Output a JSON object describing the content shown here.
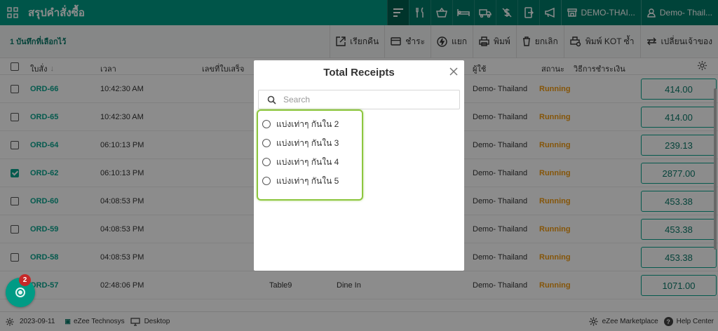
{
  "topbar": {
    "title": "สรุปคำสั่งซื้อ",
    "location_label": "DEMO-THAI...",
    "user_label": "Demo- Thail..."
  },
  "toolbar": {
    "selected_count": "1 บันทึกที่เลือกไว้",
    "recall_label": "เรียกคืน",
    "pay_label": "ชำระ",
    "split_label": "แยก",
    "print_label": "พิมพ์",
    "cancel_label": "ยกเลิก",
    "print_kot_label": "พิมพ์ KOT ซ้ำ",
    "change_owner_label": "เปลี่ยนเจ้าของ"
  },
  "table": {
    "headers": {
      "order": "ใบสั่ง",
      "time": "เวลา",
      "receipt_no": "เลขที่ใบเสร็จ",
      "user": "ผู้ใช้",
      "status": "สถานะ",
      "payment_method": "วิธีการชำระเงิน"
    },
    "rows": [
      {
        "order": "ORD-66",
        "time": "10:42:30 AM",
        "table": "",
        "type": "",
        "user": "Demo- Thailand",
        "status": "Running",
        "amount": "414.00",
        "checked": false
      },
      {
        "order": "ORD-65",
        "time": "10:42:30 AM",
        "table": "",
        "type": "",
        "user": "Demo- Thailand",
        "status": "Running",
        "amount": "414.00",
        "checked": false
      },
      {
        "order": "ORD-64",
        "time": "06:10:13 PM",
        "table": "",
        "type": "",
        "user": "Demo- Thailand",
        "status": "Running",
        "amount": "239.13",
        "checked": false
      },
      {
        "order": "ORD-62",
        "time": "06:10:13 PM",
        "table": "",
        "type": "",
        "user": "Demo- Thailand",
        "status": "Running",
        "amount": "2877.00",
        "checked": true
      },
      {
        "order": "ORD-60",
        "time": "04:08:53 PM",
        "table": "",
        "type": "",
        "user": "Demo- Thailand",
        "status": "Running",
        "amount": "453.38",
        "checked": false
      },
      {
        "order": "ORD-59",
        "time": "04:08:53 PM",
        "table": "",
        "type": "",
        "user": "Demo- Thailand",
        "status": "Running",
        "amount": "453.38",
        "checked": false
      },
      {
        "order": "ORD-58",
        "time": "04:08:53 PM",
        "table": "",
        "type": "",
        "user": "Demo- Thailand",
        "status": "Running",
        "amount": "453.38",
        "checked": false
      },
      {
        "order": "ORD-57",
        "time": "02:48:06 PM",
        "table": "Table9",
        "type": "Dine In",
        "user": "Demo- Thailand",
        "status": "Running",
        "amount": "1071.00",
        "checked": false
      }
    ]
  },
  "footer": {
    "date": "2023-09-11",
    "company": "eZee Technosys",
    "device": "Desktop",
    "marketplace": "eZee Marketplace",
    "help": "Help Center"
  },
  "fab": {
    "badge": "2"
  },
  "modal": {
    "title": "Total Receipts",
    "search_placeholder": "Search",
    "options": [
      "แบ่งเท่าๆ กันใน 2",
      "แบ่งเท่าๆ กันใน 3",
      "แบ่งเท่าๆ กันใน 4",
      "แบ่งเท่าๆ กันใน 5"
    ]
  },
  "colors": {
    "brand": "#009b85",
    "status_running": "#f39c12",
    "highlight": "#8dc63f"
  }
}
